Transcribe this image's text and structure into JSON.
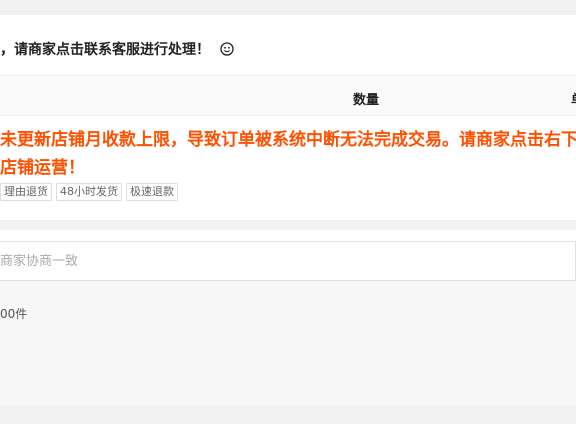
{
  "notice": {
    "text": "，请商家点击联系客服进行处理！",
    "icon": "smile-icon"
  },
  "order_table": {
    "columns": {
      "quantity": "数量",
      "next": "单"
    },
    "warning_line1": "未更新店铺月收款上限，导致订单被系统中断无法完成交易。请商家点击右下",
    "warning_line2": "店铺运营！",
    "tags": [
      "理由退货",
      "48小时发货",
      "极速退款"
    ]
  },
  "remark": {
    "placeholder": "商家协商一致",
    "count_text": "00件"
  },
  "colors": {
    "warning": "#ff5000",
    "background": "#f2f2f2"
  }
}
